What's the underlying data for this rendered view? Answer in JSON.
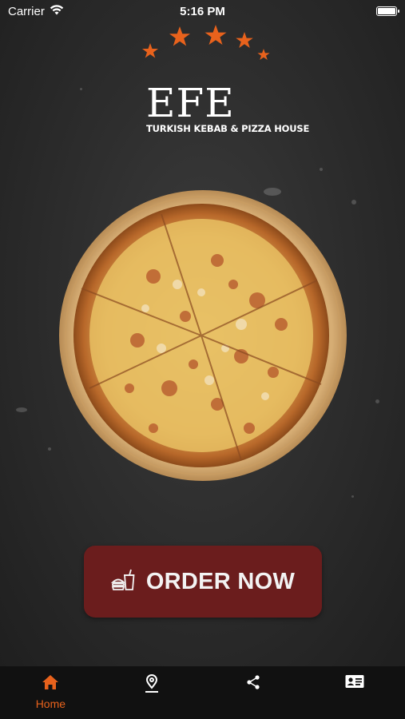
{
  "status_bar": {
    "carrier": "Carrier",
    "time": "5:16 PM"
  },
  "logo": {
    "name": "EFE",
    "tagline": "TURKISH KEBAB & PIZZA HOUSE"
  },
  "order_button": {
    "label": "ORDER NOW",
    "icon": "fast-food-icon"
  },
  "tabs": [
    {
      "label": "Home",
      "icon": "home-icon",
      "active": true
    },
    {
      "label": "",
      "icon": "location-icon",
      "active": false
    },
    {
      "label": "",
      "icon": "share-icon",
      "active": false
    },
    {
      "label": "",
      "icon": "contact-card-icon",
      "active": false
    }
  ],
  "colors": {
    "accent": "#e8621c",
    "button": "#6b1d1d",
    "tab_bar": "#111111",
    "icon_inactive": "#ffffff"
  }
}
